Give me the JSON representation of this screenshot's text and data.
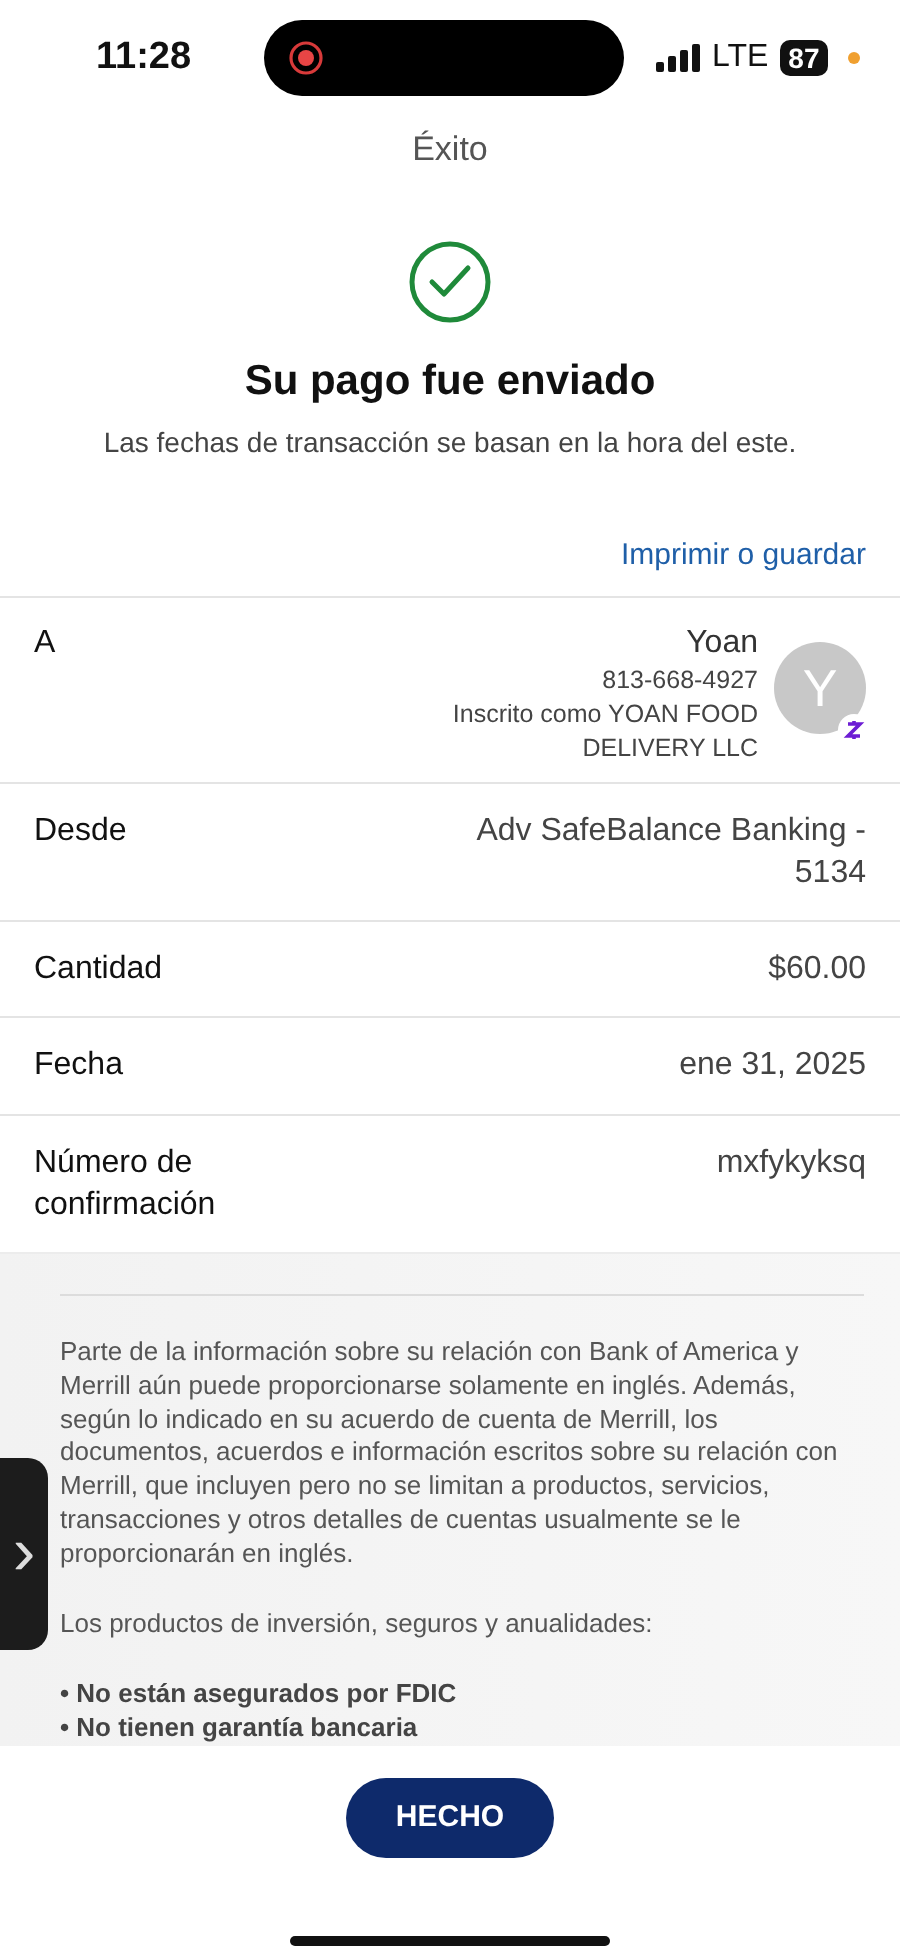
{
  "status_bar": {
    "time": "11:28",
    "recording": true,
    "network": "LTE",
    "battery": "87"
  },
  "header": {
    "title": "Éxito"
  },
  "confirmation": {
    "heading": "Su pago fue enviado",
    "subtitle": "Las fechas de transacción se basan en la hora del este.",
    "link": "Imprimir o guardar"
  },
  "recipient": {
    "label": "A",
    "name": "Yoan",
    "phone": "813-668-4927",
    "enrolled_as": "Inscrito como YOAN FOOD DELIVERY LLC",
    "avatar_letter": "Y"
  },
  "details": [
    {
      "label": "Desde",
      "value": "Adv SafeBalance Banking - 5134"
    },
    {
      "label": "Cantidad",
      "value": "$60.00"
    },
    {
      "label": "Fecha",
      "value": "ene 31, 2025"
    },
    {
      "label": "Número de confirmación",
      "value": "mxfykyksq"
    }
  ],
  "disclosure": {
    "paragraph": "Parte de la información sobre su relación con Bank of America y Merrill aún puede proporcionarse solamente en inglés. Además, según lo indicado en su acuerdo de cuenta de Merrill, los documentos, acuerdos e información escritos sobre su relación con Merrill, que incluyen pero no se limitan a productos, servicios, transacciones y otros detalles de cuentas usualmente se le proporcionarán en inglés.",
    "intro": "Los productos de inversión, seguros y anualidades:",
    "bullets": [
      "• No están asegurados por FDIC",
      "• No tienen garantía bancaria"
    ]
  },
  "side_handle": {
    "glyph": "›"
  },
  "done_button": "HECHO"
}
